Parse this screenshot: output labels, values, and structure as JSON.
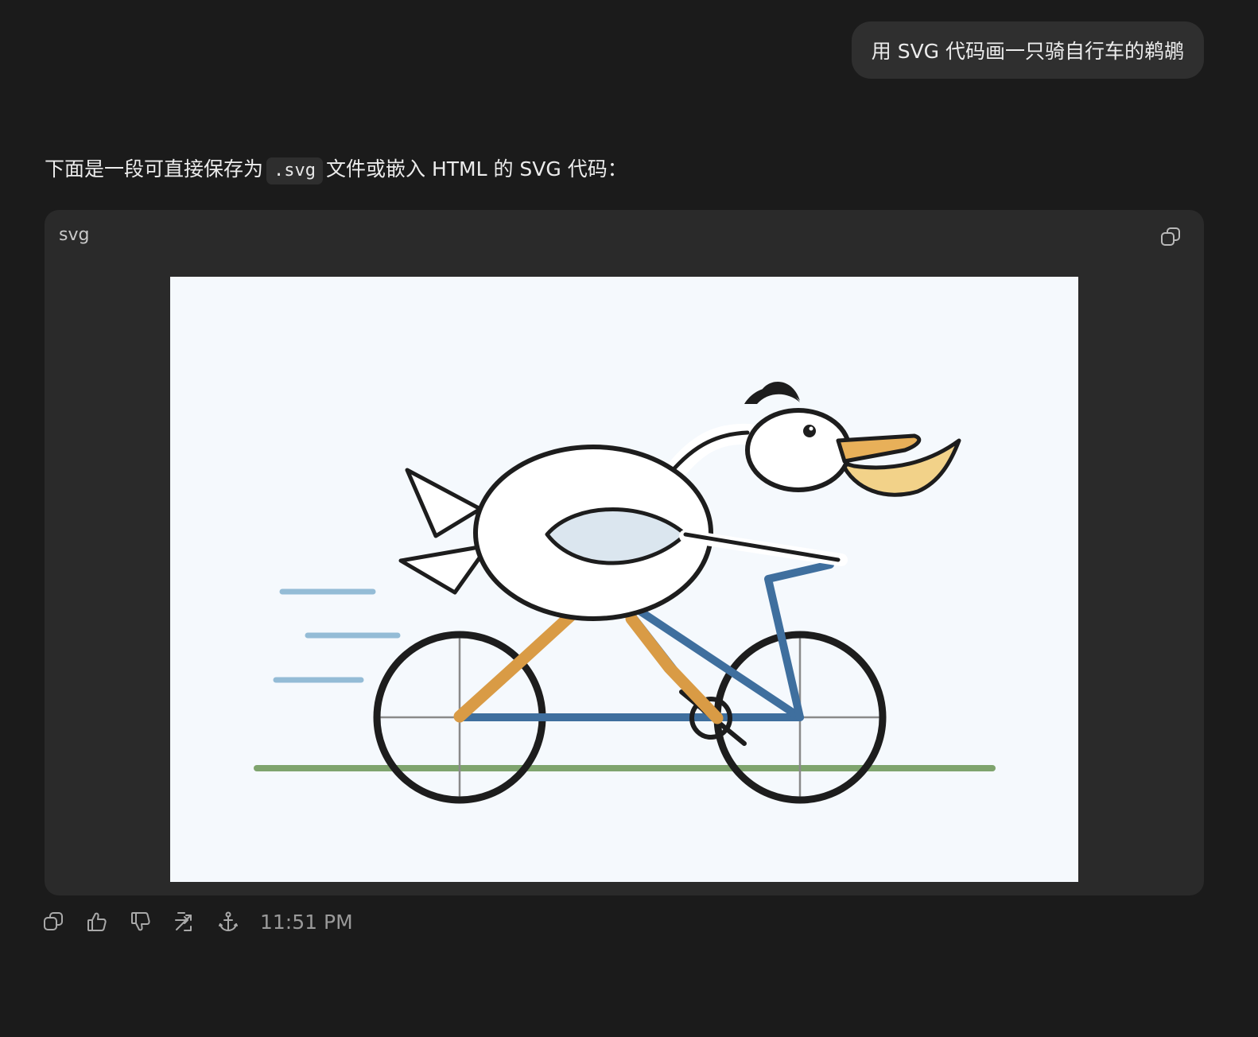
{
  "user_message": "用 SVG 代码画一只骑自行车的鹈鹕",
  "assistant": {
    "intro_before": "下面是一段可直接保存为",
    "intro_code": ".svg",
    "intro_after": "文件或嵌入 HTML 的 SVG 代码："
  },
  "code_block": {
    "language": "svg",
    "copy_icon": "copy-icon"
  },
  "illustration": {
    "subject": "pelican riding a bicycle",
    "colors": {
      "background": "#f5f9fd",
      "frame": "#3f6f9e",
      "legs": "#d99b45",
      "beak": "#e8b059",
      "pouch": "#f2d289",
      "wing": "#dbe6ef",
      "ground": "#7fa46e",
      "speed_lines": "#94bcd6",
      "outline": "#1d1d1d"
    }
  },
  "actions": {
    "icons": [
      "copy-icon",
      "thumbs-up-icon",
      "thumbs-down-icon",
      "share-icon",
      "anchor-icon"
    ],
    "timestamp": "11:51 PM"
  }
}
